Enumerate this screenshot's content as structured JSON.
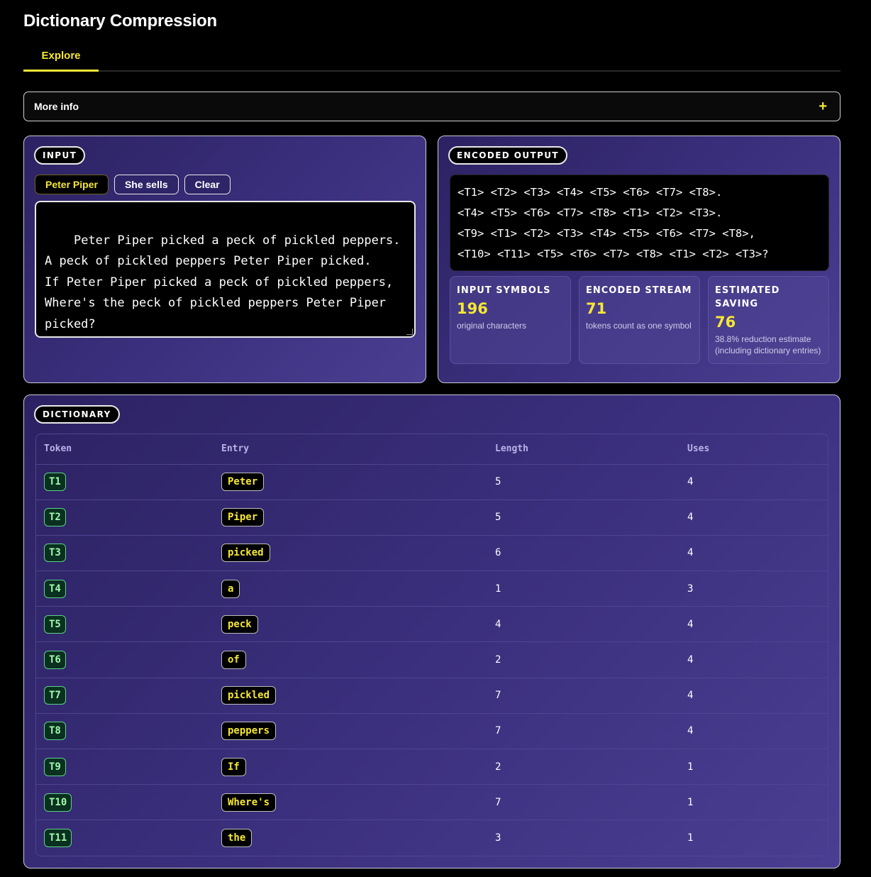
{
  "app": {
    "title": "Dictionary Compression"
  },
  "tabs": [
    {
      "label": "Explore"
    }
  ],
  "more_info": {
    "label": "More info",
    "toggle": "+"
  },
  "input_panel": {
    "tag": "INPUT",
    "presets": [
      "Peter Piper",
      "She sells",
      "Clear"
    ],
    "active_preset": "Peter Piper",
    "text": "Peter Piper picked a peck of pickled peppers.\nA peck of pickled peppers Peter Piper picked.\nIf Peter Piper picked a peck of pickled peppers,\nWhere's the peck of pickled peppers Peter Piper\npicked?"
  },
  "output_panel": {
    "tag": "ENCODED OUTPUT",
    "encoded_lines": [
      "<T1> <T2> <T3> <T4> <T5> <T6> <T7> <T8>.",
      "<T4> <T5> <T6> <T7> <T8> <T1> <T2> <T3>.",
      "<T9> <T1> <T2> <T3> <T4> <T5> <T6> <T7> <T8>,",
      "<T10> <T11> <T5> <T6> <T7> <T8> <T1> <T2> <T3>?"
    ],
    "stats": [
      {
        "label": "INPUT SYMBOLS",
        "value": "196",
        "desc": "original characters"
      },
      {
        "label": "ENCODED STREAM",
        "value": "71",
        "desc": "tokens count as one symbol"
      },
      {
        "label": "ESTIMATED SAVING",
        "value": "76",
        "desc": "38.8% reduction estimate (including dictionary entries)"
      }
    ]
  },
  "dictionary": {
    "tag": "DICTIONARY",
    "columns": [
      "Token",
      "Entry",
      "Length",
      "Uses"
    ],
    "rows": [
      {
        "token": "T1",
        "entry": "Peter",
        "length": "5",
        "uses": "4"
      },
      {
        "token": "T2",
        "entry": "Piper",
        "length": "5",
        "uses": "4"
      },
      {
        "token": "T3",
        "entry": "picked",
        "length": "6",
        "uses": "4"
      },
      {
        "token": "T4",
        "entry": "a",
        "length": "1",
        "uses": "3"
      },
      {
        "token": "T5",
        "entry": "peck",
        "length": "4",
        "uses": "4"
      },
      {
        "token": "T6",
        "entry": "of",
        "length": "2",
        "uses": "4"
      },
      {
        "token": "T7",
        "entry": "pickled",
        "length": "7",
        "uses": "4"
      },
      {
        "token": "T8",
        "entry": "peppers",
        "length": "7",
        "uses": "4"
      },
      {
        "token": "T9",
        "entry": "If",
        "length": "2",
        "uses": "1"
      },
      {
        "token": "T10",
        "entry": "Where's",
        "length": "7",
        "uses": "1"
      },
      {
        "token": "T11",
        "entry": "the",
        "length": "3",
        "uses": "1"
      }
    ]
  },
  "colors": {
    "accent": "#f5e735",
    "token_green": "#9dfba8",
    "panel_purple": "#3a2f7c"
  }
}
